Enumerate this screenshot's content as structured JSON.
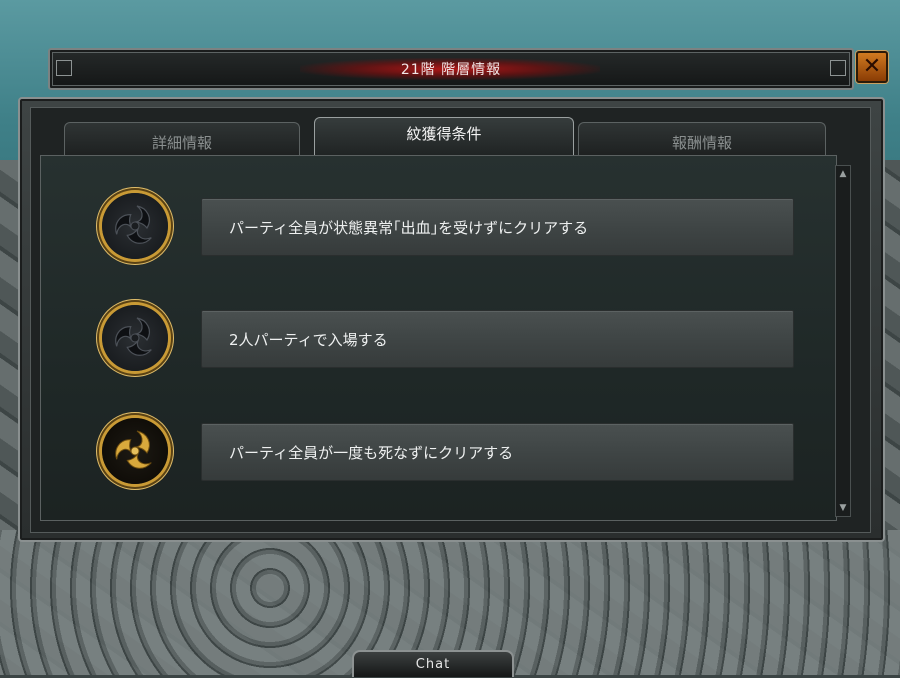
{
  "window": {
    "title": "21階 階層情報",
    "close_symbol": "✕"
  },
  "tabs": [
    {
      "label": "詳細情報",
      "active": false
    },
    {
      "label": "紋獲得条件",
      "active": true
    },
    {
      "label": "報酬情報",
      "active": false
    }
  ],
  "conditions": [
    {
      "text": "パーティ全員が状態異常｢出血｣を受けずにクリアする",
      "icon": "tomoe-crest-icon",
      "achieved": false
    },
    {
      "text": "2人パーティで入場する",
      "icon": "tomoe-crest-icon",
      "achieved": false
    },
    {
      "text": "パーティ全員が一度も死なずにクリアする",
      "icon": "tomoe-crest-icon",
      "achieved": true
    }
  ],
  "scrollbar": {
    "up": "▲",
    "down": "▼"
  },
  "chat": {
    "label": "Chat"
  },
  "colors": {
    "title_glow": "#c81414",
    "crest_gold": "#c99a35",
    "crest_dark": "#2b2f33",
    "close_button": "#d07a20"
  }
}
